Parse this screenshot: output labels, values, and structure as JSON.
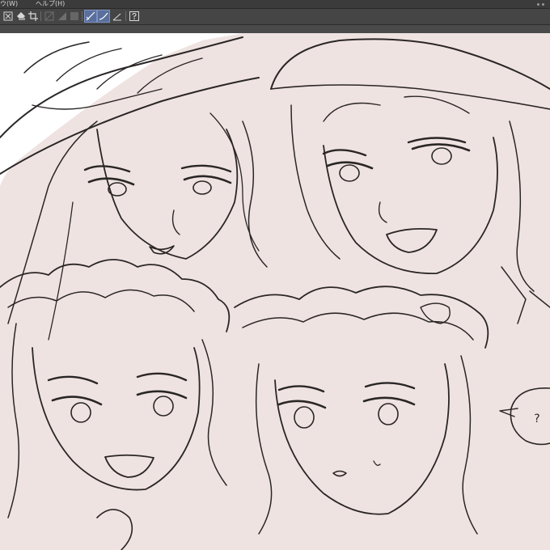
{
  "menu": {
    "window_label": "ウ(W)",
    "help_label": "ヘルプ(H)"
  },
  "toolbar": {
    "buttons": [
      {
        "icon": "clear-icon",
        "active": false,
        "enabled": true
      },
      {
        "icon": "fill-icon",
        "active": false,
        "enabled": true
      },
      {
        "icon": "crop-icon",
        "active": false,
        "enabled": true
      },
      {
        "icon": "transform-disabled-icon",
        "active": false,
        "enabled": false
      },
      {
        "icon": "gradient-disabled-icon",
        "active": false,
        "enabled": false
      },
      {
        "icon": "square-disabled-icon",
        "active": false,
        "enabled": false
      },
      {
        "icon": "snap-ruler-icon",
        "active": true,
        "enabled": true
      },
      {
        "icon": "snap-curve-icon",
        "active": true,
        "enabled": true
      },
      {
        "icon": "snap-special-ruler-icon",
        "active": false,
        "enabled": true
      },
      {
        "icon": "help-icon",
        "active": false,
        "enabled": true
      }
    ]
  },
  "canvas": {
    "paper_color": "#ffffff",
    "layer_fill_color": "#efe3e1",
    "line_color": "#2a2626"
  },
  "illustration": {
    "speech_bubble_text": "?"
  }
}
